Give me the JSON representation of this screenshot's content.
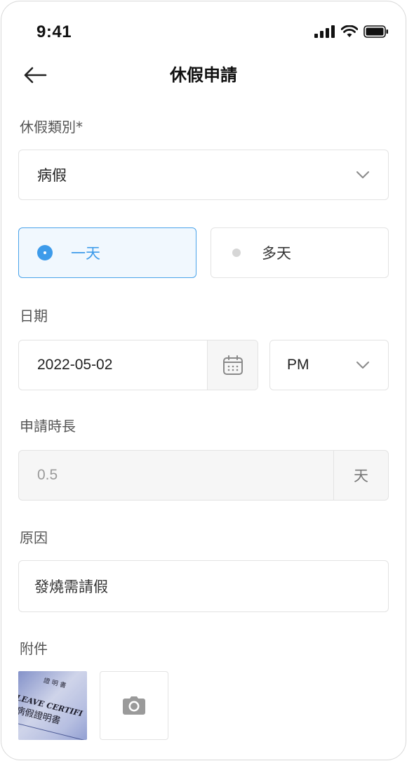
{
  "status_bar": {
    "time": "9:41"
  },
  "header": {
    "title": "休假申請"
  },
  "leave_type": {
    "label": "休假類別*",
    "value": "病假"
  },
  "duration_mode": {
    "options": [
      {
        "label": "一天",
        "selected": true
      },
      {
        "label": "多天",
        "selected": false
      }
    ]
  },
  "date": {
    "label": "日期",
    "value": "2022-05-02",
    "period": "PM"
  },
  "length": {
    "label": "申請時長",
    "value": "0.5",
    "unit": "天"
  },
  "reason": {
    "label": "原因",
    "value": "發燒需請假"
  },
  "attachments": {
    "label": "附件",
    "thumbnail_text": "LEAVE CERTIFI"
  },
  "colors": {
    "accent": "#3d9bea",
    "accent_bg": "#f1f8fe",
    "border": "#e3e3e3",
    "muted_bg": "#f6f6f6"
  },
  "icons": [
    "signal-icon",
    "wifi-icon",
    "battery-icon",
    "back-arrow-icon",
    "chevron-down-icon",
    "calendar-icon",
    "camera-icon"
  ]
}
